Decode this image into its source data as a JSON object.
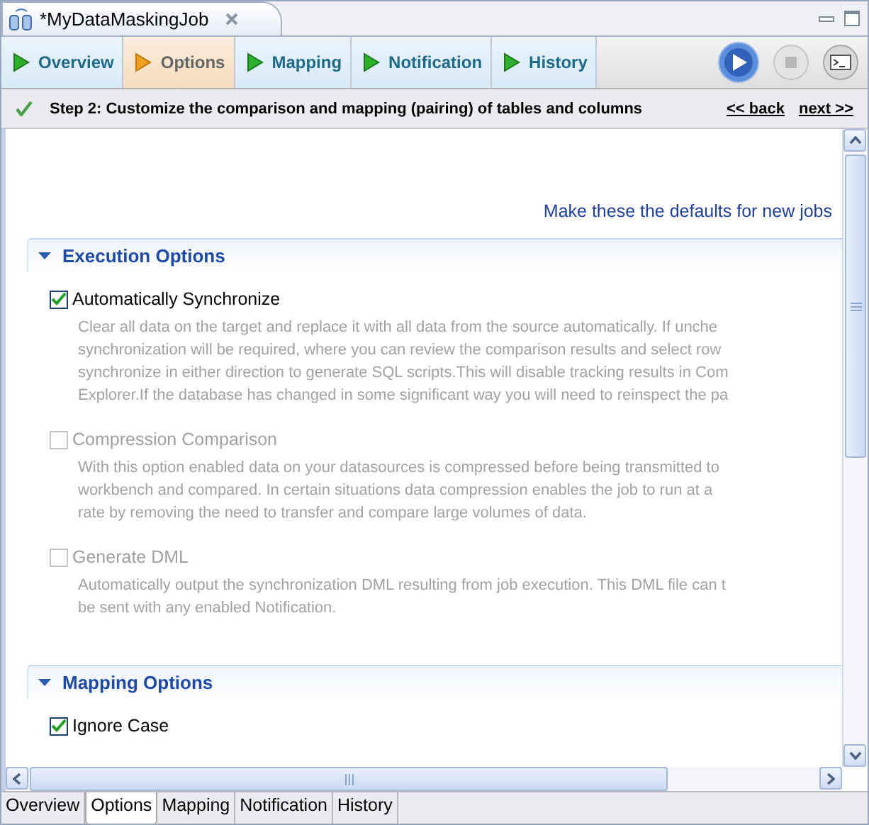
{
  "editor_tab": {
    "title": "*MyDataMaskingJob"
  },
  "page_tabs": [
    {
      "label": "Overview",
      "selected": false
    },
    {
      "label": "Options",
      "selected": true
    },
    {
      "label": "Mapping",
      "selected": false
    },
    {
      "label": "Notification",
      "selected": false
    },
    {
      "label": "History",
      "selected": false
    }
  ],
  "step": {
    "text": "Step 2: Customize the comparison and mapping (pairing) of tables and columns",
    "nav_links": [
      "<< back",
      "next >>"
    ]
  },
  "defaults_link": "Make these the defaults for new jobs",
  "sections": [
    {
      "title": "Execution Options",
      "expanded": true,
      "options": [
        {
          "label": "Automatically Synchronize",
          "checked": true,
          "disabled": false,
          "description": [
            "Clear all data on the target and replace it with all data from the source automatically. If unche",
            "synchronization will be required, where you can review the comparison results and select row",
            "synchronize in either direction to generate SQL scripts.This will disable tracking results in Com",
            "Explorer.If the database has changed in some significant way you will need to reinspect the pa"
          ]
        },
        {
          "label": "Compression Comparison",
          "checked": false,
          "disabled": true,
          "description": [
            "With this option enabled data on your datasources is compressed before being transmitted to",
            "workbench and compared. In certain situations data compression enables the job to run at a",
            "rate by removing the need to transfer and compare large volumes of data."
          ]
        },
        {
          "label": "Generate DML",
          "checked": false,
          "disabled": true,
          "description": [
            "Automatically output the synchronization DML resulting from job execution. This DML file can t",
            "be sent with any enabled Notification."
          ]
        }
      ]
    },
    {
      "title": "Mapping Options",
      "expanded": true,
      "options": [
        {
          "label": "Ignore Case",
          "checked": true,
          "disabled": false
        }
      ]
    }
  ],
  "bottom_tabs": [
    {
      "label": "Overview",
      "selected": false
    },
    {
      "label": "Options",
      "selected": true
    },
    {
      "label": "Mapping",
      "selected": false
    },
    {
      "label": "Notification",
      "selected": false
    },
    {
      "label": "History",
      "selected": false
    }
  ]
}
